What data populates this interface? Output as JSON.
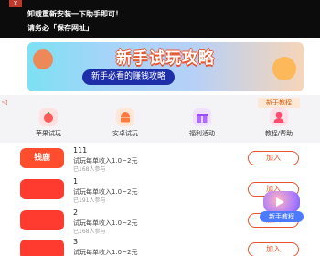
{
  "notice": {
    "close_label": "X",
    "line1": "卸载重新安装一下助手即可！",
    "line2": "请务必「保存网址」"
  },
  "banner": {
    "title": "新手试玩攻略",
    "subtitle": "新手必看的赚钱攻略"
  },
  "tutorial_tab": "新手教程",
  "categories": [
    {
      "label": "苹果试玩",
      "icon": "apple-icon",
      "color": "#ff6b6b"
    },
    {
      "label": "安卓试玩",
      "icon": "android-icon",
      "color": "#ff7a3d"
    },
    {
      "label": "福利活动",
      "icon": "gift-icon",
      "color": "#b06cff"
    },
    {
      "label": "教程/帮助",
      "icon": "help-person-icon",
      "color": "#ff4d6d"
    }
  ],
  "list": [
    {
      "logo_text": "钱鹿",
      "logo_color": "#ff4d2e",
      "name": "111",
      "desc": "试玩每单收入1.0~2元",
      "meta": "已168人参与",
      "action": "加入"
    },
    {
      "logo_text": "",
      "logo_color": "#ff3b30",
      "name": "1",
      "desc": "试玩每单收入1.0~2元",
      "meta": "已191人参与",
      "action": "加入"
    },
    {
      "logo_text": "",
      "logo_color": "#ff3b30",
      "name": "2",
      "desc": "试玩每单收入1.0~2元",
      "meta": "已168人参与",
      "action": "加入"
    },
    {
      "logo_text": "",
      "logo_color": "#ff3b30",
      "name": "3",
      "desc": "试玩每单收入1.0~2元",
      "meta": "",
      "action": "加入"
    }
  ],
  "floating": {
    "label": "新手教程"
  }
}
